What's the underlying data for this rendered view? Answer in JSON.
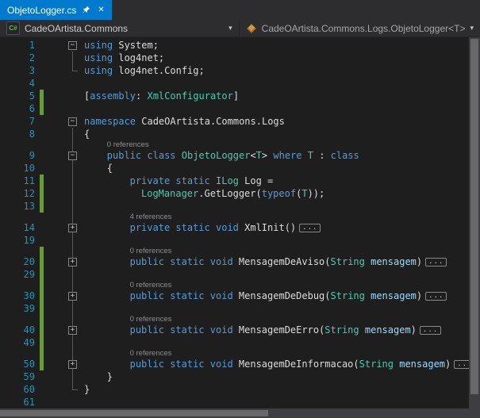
{
  "tab": {
    "title": "ObjetoLogger.cs"
  },
  "navbar": {
    "project_icon": "C#",
    "project": "CadeOArtista.Commons",
    "member": "CadeOArtista.Commons.Logs.ObjetoLogger<T>"
  },
  "icons": {
    "close": "✕",
    "dropdown": "▾",
    "minus": "−",
    "plus": "+",
    "ellipsis": "..."
  },
  "colors": {
    "accent": "#007ACC",
    "background": "#1E1E1E",
    "keyword": "#569CD6",
    "type": "#4EC9B0",
    "text": "#DCDCDC",
    "parameter": "#9CDCFE",
    "line_number": "#2B91AF",
    "change_bar": "#6A9A3B",
    "codelens": "#8F8F8F"
  },
  "code": {
    "lines": [
      {
        "n": 1,
        "ol": "m",
        "tok": [
          [
            "kw",
            "using"
          ],
          [
            "pl",
            " System;"
          ]
        ]
      },
      {
        "n": 2,
        "ol": "l",
        "tok": [
          [
            "kw",
            "using"
          ],
          [
            "pl",
            " log4net;"
          ]
        ]
      },
      {
        "n": 3,
        "ol": "e",
        "tok": [
          [
            "kw",
            "using"
          ],
          [
            "pl",
            " log4net.Config;"
          ]
        ]
      },
      {
        "n": 4,
        "ol": "",
        "tok": []
      },
      {
        "n": 5,
        "ol": "",
        "chg": true,
        "tok": [
          [
            "pl",
            "["
          ],
          [
            "kw",
            "assembly"
          ],
          [
            "pl",
            ": "
          ],
          [
            "ty",
            "XmlConfigurator"
          ],
          [
            "pl",
            "]"
          ]
        ]
      },
      {
        "n": 6,
        "ol": "",
        "chg": true,
        "tok": []
      },
      {
        "n": 7,
        "ol": "m",
        "tok": [
          [
            "kw",
            "namespace"
          ],
          [
            "pl",
            " CadeOArtista.Commons.Logs"
          ]
        ]
      },
      {
        "n": 8,
        "ol": "l",
        "tok": [
          [
            "pl",
            "{"
          ]
        ]
      },
      {
        "n": 9,
        "ol": "ml",
        "ind": 4,
        "lens": "0 references",
        "tok": [
          [
            "kw",
            "public"
          ],
          [
            "pl",
            " "
          ],
          [
            "kw",
            "class"
          ],
          [
            "pl",
            " "
          ],
          [
            "ty",
            "ObjetoLogger"
          ],
          [
            "pl",
            "<"
          ],
          [
            "ty",
            "T"
          ],
          [
            "pl",
            "> "
          ],
          [
            "kw",
            "where"
          ],
          [
            "pl",
            " "
          ],
          [
            "ty",
            "T"
          ],
          [
            "pl",
            " : "
          ],
          [
            "kw",
            "class"
          ]
        ]
      },
      {
        "n": 10,
        "ol": "l",
        "ind": 4,
        "tok": [
          [
            "pl",
            "{"
          ]
        ]
      },
      {
        "n": 11,
        "ol": "l",
        "ind": 8,
        "chg": true,
        "tok": [
          [
            "kw",
            "private"
          ],
          [
            "pl",
            " "
          ],
          [
            "kw",
            "static"
          ],
          [
            "pl",
            " "
          ],
          [
            "ty",
            "ILog"
          ],
          [
            "pl",
            " Log ="
          ]
        ]
      },
      {
        "n": 12,
        "ol": "l",
        "ind": 10,
        "chg": true,
        "tok": [
          [
            "ty",
            "LogManager"
          ],
          [
            "pl",
            ".GetLogger("
          ],
          [
            "kw",
            "typeof"
          ],
          [
            "pl",
            "("
          ],
          [
            "ty",
            "T"
          ],
          [
            "pl",
            "));"
          ]
        ]
      },
      {
        "n": 13,
        "ol": "l",
        "chg": true,
        "tok": []
      },
      {
        "n": 14,
        "ol": "pl",
        "ind": 8,
        "lens": "4 references",
        "fold": true,
        "tok": [
          [
            "kw",
            "private"
          ],
          [
            "pl",
            " "
          ],
          [
            "kw",
            "static"
          ],
          [
            "pl",
            " "
          ],
          [
            "kw",
            "void"
          ],
          [
            "pl",
            " XmlInit()"
          ]
        ]
      },
      {
        "n": 19,
        "ol": "l",
        "tok": []
      },
      {
        "n": 20,
        "ol": "pl",
        "ind": 8,
        "chg": true,
        "lens": "0 references",
        "fold": true,
        "tok": [
          [
            "kw",
            "public"
          ],
          [
            "pl",
            " "
          ],
          [
            "kw",
            "static"
          ],
          [
            "pl",
            " "
          ],
          [
            "kw",
            "void"
          ],
          [
            "pl",
            " MensagemDeAviso("
          ],
          [
            "ty",
            "String"
          ],
          [
            "pm",
            " mensagem"
          ],
          [
            "pl",
            ")"
          ]
        ]
      },
      {
        "n": 29,
        "ol": "l",
        "chg": true,
        "tok": []
      },
      {
        "n": 30,
        "ol": "pl",
        "ind": 8,
        "chg": true,
        "lens": "0 references",
        "fold": true,
        "tok": [
          [
            "kw",
            "public"
          ],
          [
            "pl",
            " "
          ],
          [
            "kw",
            "static"
          ],
          [
            "pl",
            " "
          ],
          [
            "kw",
            "void"
          ],
          [
            "pl",
            " MensagemDeDebug("
          ],
          [
            "ty",
            "String"
          ],
          [
            "pm",
            " mensagem"
          ],
          [
            "pl",
            ")"
          ]
        ]
      },
      {
        "n": 39,
        "ol": "l",
        "chg": true,
        "tok": []
      },
      {
        "n": 40,
        "ol": "pl",
        "ind": 8,
        "chg": true,
        "lens": "0 references",
        "fold": true,
        "tok": [
          [
            "kw",
            "public"
          ],
          [
            "pl",
            " "
          ],
          [
            "kw",
            "static"
          ],
          [
            "pl",
            " "
          ],
          [
            "kw",
            "void"
          ],
          [
            "pl",
            " MensagemDeErro("
          ],
          [
            "ty",
            "String"
          ],
          [
            "pm",
            " mensagem"
          ],
          [
            "pl",
            ")"
          ]
        ]
      },
      {
        "n": 49,
        "ol": "l",
        "chg": true,
        "tok": []
      },
      {
        "n": 50,
        "ol": "pl",
        "ind": 8,
        "chg": true,
        "lens": "0 references",
        "fold": true,
        "tok": [
          [
            "kw",
            "public"
          ],
          [
            "pl",
            " "
          ],
          [
            "kw",
            "static"
          ],
          [
            "pl",
            " "
          ],
          [
            "kw",
            "void"
          ],
          [
            "pl",
            " MensagemDeInformacao("
          ],
          [
            "ty",
            "String"
          ],
          [
            "pm",
            " mensagem"
          ],
          [
            "pl",
            ")"
          ]
        ]
      },
      {
        "n": 59,
        "ol": "l",
        "ind": 4,
        "tok": [
          [
            "pl",
            "}"
          ]
        ]
      },
      {
        "n": 60,
        "ol": "e",
        "tok": [
          [
            "pl",
            "}"
          ]
        ]
      },
      {
        "n": 61,
        "ol": "",
        "tok": []
      }
    ]
  }
}
